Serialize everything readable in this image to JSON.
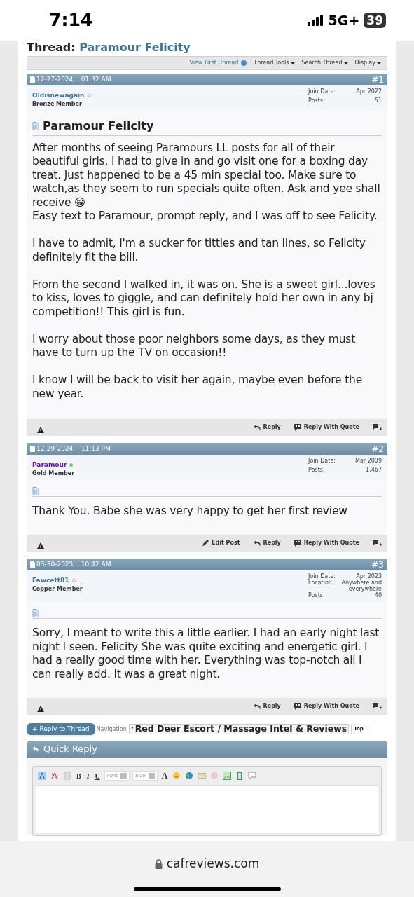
{
  "status_bar": {
    "time": "7:14",
    "network": "5G+",
    "battery": "39"
  },
  "thread": {
    "prefix": "Thread:",
    "title": "Paramour Felicity"
  },
  "thread_toolbar": [
    {
      "label": "View First Unread",
      "kind": "link"
    },
    {
      "label": "Thread Tools",
      "kind": "menu"
    },
    {
      "label": "Search Thread",
      "kind": "menu"
    },
    {
      "label": "Display",
      "kind": "menu"
    }
  ],
  "posts": [
    {
      "date": "12-27-2024,",
      "time": "01:32 AM",
      "number": "#1",
      "author": "Oldisnewagain",
      "online": false,
      "color": "#417394",
      "rank": "Bronze Member",
      "info": [
        {
          "label": "Join Date:",
          "value": "Apr 2022"
        },
        {
          "label": "Posts:",
          "value": "51"
        }
      ],
      "title": "Paramour Felicity",
      "body": [
        [
          "After months of seeing Paramours LL posts for all of their beautiful girls, I had to give in and go visit one for a boxing day treat. Just happened to be a 45 min special too. Make sure to watch,as they seem to run specials quite often. Ask and yee shall receive 😁",
          "Easy text to Paramour, prompt reply, and I was off to see Felicity."
        ],
        [
          "I have to admit, I'm a sucker for titties and tan lines, so Felicity definitely fit the bill."
        ],
        [
          "From the second I walked in, it was on. She is a sweet girl...loves to kiss, loves to giggle, and can definitely hold her own in any bj competition!! This girl is fun."
        ],
        [
          "I worry about those poor neighbors some days, as they must have to turn up the TV on occasion!!"
        ],
        [
          "I know I will be back to visit her again, maybe even before the new year."
        ]
      ],
      "actions": [
        "Reply",
        "Reply With Quote"
      ]
    },
    {
      "date": "12-29-2024,",
      "time": "11:13 PM",
      "number": "#2",
      "author": "Paramour",
      "online": true,
      "color": "#6a0dad",
      "rank": "Gold Member",
      "info": [
        {
          "label": "Join Date:",
          "value": "Mar 2009"
        },
        {
          "label": "Posts:",
          "value": "1,467"
        }
      ],
      "body": [
        [
          "Thank You. Babe she was very happy to get her first review"
        ]
      ],
      "actions": [
        "Edit Post",
        "Reply",
        "Reply With Quote"
      ]
    },
    {
      "date": "03-30-2025,",
      "time": "10:42 AM",
      "number": "#3",
      "author": "Fawcett81",
      "online": false,
      "color": "#417394",
      "rank": "Copper Member",
      "info": [
        {
          "label": "Join Date:",
          "value": "Apr 2023"
        },
        {
          "label": "Location:",
          "value": "Anywhere and everywhere"
        },
        {
          "label": "Posts:",
          "value": "40"
        }
      ],
      "body": [
        [
          "Sorry, I meant to write this a little earlier. I had an early night last night I seen. Felicity She was quite exciting and energetic girl. I had a really good time with her. Everything was top-notch all I can really add. It was a great night."
        ]
      ],
      "actions": [
        "Reply",
        "Reply With Quote"
      ]
    }
  ],
  "reply_button": "+ Reply to Thread",
  "quick_navigation": {
    "label": "Navigation",
    "value": "Red Deer Escort / Massage Intel & Reviews",
    "top": "Top"
  },
  "quick_reply": {
    "title": "Quick Reply",
    "toolbar": [
      {
        "kind": "icon"
      },
      {
        "kind": "icon"
      },
      {
        "kind": "icon"
      },
      {
        "kind": "text",
        "label": "B"
      },
      {
        "kind": "text",
        "label": "I"
      },
      {
        "kind": "text",
        "label": "U"
      },
      {
        "kind": "select",
        "label": "Font"
      },
      {
        "kind": "select",
        "label": "Size"
      },
      {
        "kind": "text",
        "label": "A"
      },
      {
        "kind": "icon"
      },
      {
        "kind": "icon"
      },
      {
        "kind": "icon"
      },
      {
        "kind": "icon"
      },
      {
        "kind": "icon"
      },
      {
        "kind": "icon"
      },
      {
        "kind": "icon"
      }
    ]
  },
  "url_bar": {
    "domain": "cafreviews.com"
  }
}
